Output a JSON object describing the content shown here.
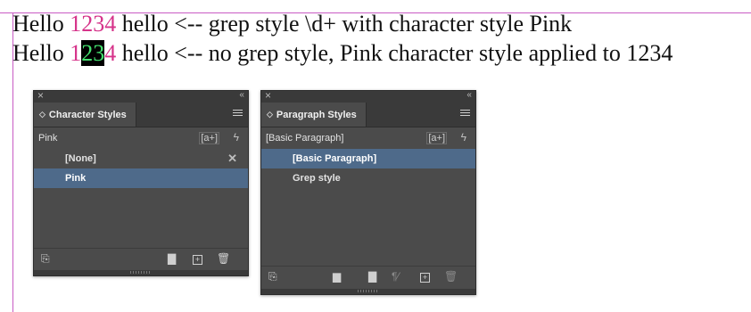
{
  "document": {
    "line1": {
      "prefix": "Hello ",
      "digits": "1234",
      "suffix": " hello <-- grep style \\d+ with character style Pink"
    },
    "line2": {
      "prefix": "Hello ",
      "digits_a": "1",
      "digits_selected": "23",
      "digits_b": "4",
      "suffix": " hello <-- no grep style, Pink character style applied to 1234"
    },
    "colors": {
      "pink": "#d6338a",
      "selection_text": "#44e06e",
      "margin_guide": "#c85bc4"
    }
  },
  "character_panel": {
    "title": "Character Styles",
    "current_style": "Pink",
    "new_from_selection_label": "[a+]",
    "items": [
      {
        "label": "[None]",
        "selected": false
      },
      {
        "label": "Pink",
        "selected": true
      }
    ],
    "icons": [
      "close-icon",
      "collapse-icon",
      "panel-menu-icon",
      "lightning-icon",
      "no-override-icon",
      "load-styles-icon",
      "folder-icon",
      "new-style-icon",
      "trash-icon"
    ]
  },
  "paragraph_panel": {
    "title": "Paragraph Styles",
    "current_style": "[Basic Paragraph]",
    "new_from_selection_label": "[a+]",
    "items": [
      {
        "label": "[Basic Paragraph]",
        "selected": true
      },
      {
        "label": "Grep style",
        "selected": false
      }
    ],
    "icons": [
      "close-icon",
      "collapse-icon",
      "panel-menu-icon",
      "lightning-icon",
      "load-styles-icon",
      "folder-load-icon",
      "folder-icon",
      "clear-overrides-icon",
      "new-style-icon",
      "trash-icon"
    ]
  },
  "theme": {
    "panel_bg": "#4b4b4b",
    "tab_bar_bg": "#3a3a3a",
    "selected_row": "#4e6a8a"
  }
}
